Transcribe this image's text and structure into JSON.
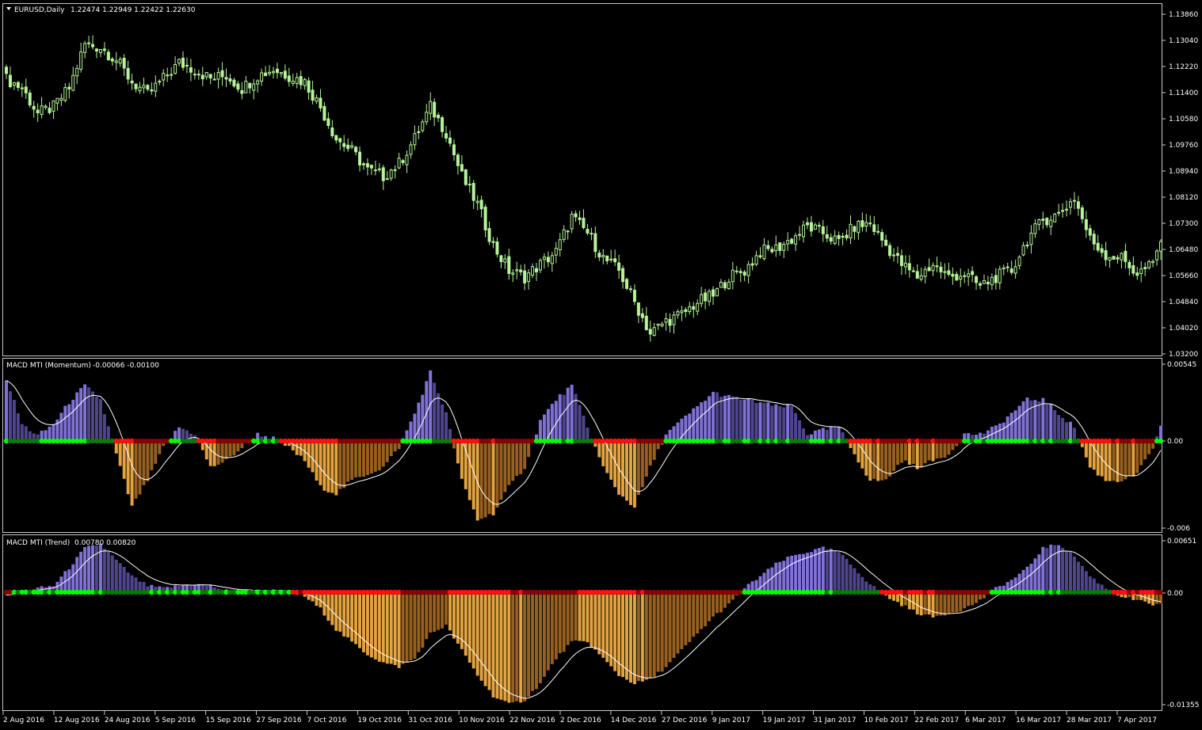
{
  "colors": {
    "background": "#000000",
    "candle": "#b6f39a",
    "hist_pos_strong": "#8071d8",
    "hist_pos_weak": "#4f458d",
    "hist_neg_strong": "#e3a33f",
    "hist_neg_weak": "#98601f",
    "dot_red": "#ff1010",
    "dot_darkred": "#8a0000",
    "dot_green": "#00ff00",
    "dot_darkgreen": "#0a7a0a",
    "signal_line": "#ffffff",
    "border": "#c8c8c8"
  },
  "chart_data": [
    {
      "type": "candlestick",
      "symbol_label": "EURUSD,Daily",
      "ohlc_label": "1.22474 1.22949 1.22422 1.22630",
      "ylim": [
        1.032,
        1.14
      ],
      "y_ticks": [
        "1.13860",
        "1.13040",
        "1.12220",
        "1.11400",
        "1.10580",
        "1.09760",
        "1.08940",
        "1.08120",
        "1.07300",
        "1.06480",
        "1.05660",
        "1.04840",
        "1.04020",
        "1.03200"
      ],
      "closes_anchor": [
        [
          0,
          1.121
        ],
        [
          4,
          1.118
        ],
        [
          8,
          1.11
        ],
        [
          12,
          1.112
        ],
        [
          16,
          1.118
        ],
        [
          20,
          1.132
        ],
        [
          24,
          1.131
        ],
        [
          28,
          1.127
        ],
        [
          32,
          1.12
        ],
        [
          36,
          1.116
        ],
        [
          40,
          1.121
        ],
        [
          44,
          1.126
        ],
        [
          48,
          1.124
        ],
        [
          52,
          1.121
        ],
        [
          56,
          1.122
        ],
        [
          60,
          1.118
        ],
        [
          64,
          1.122
        ],
        [
          68,
          1.124
        ],
        [
          72,
          1.122
        ],
        [
          76,
          1.12
        ],
        [
          80,
          1.112
        ],
        [
          84,
          1.102
        ],
        [
          88,
          1.098
        ],
        [
          92,
          1.092
        ],
        [
          96,
          1.09
        ],
        [
          100,
          1.094
        ],
        [
          104,
          1.102
        ],
        [
          108,
          1.112
        ],
        [
          112,
          1.104
        ],
        [
          116,
          1.09
        ],
        [
          120,
          1.081
        ],
        [
          124,
          1.068
        ],
        [
          128,
          1.06
        ],
        [
          132,
          1.058
        ],
        [
          136,
          1.062
        ],
        [
          140,
          1.066
        ],
        [
          144,
          1.077
        ],
        [
          148,
          1.072
        ],
        [
          152,
          1.064
        ],
        [
          156,
          1.06
        ],
        [
          160,
          1.05
        ],
        [
          164,
          1.04
        ],
        [
          168,
          1.044
        ],
        [
          172,
          1.046
        ],
        [
          176,
          1.05
        ],
        [
          180,
          1.052
        ],
        [
          184,
          1.058
        ],
        [
          188,
          1.06
        ],
        [
          192,
          1.066
        ],
        [
          196,
          1.067
        ],
        [
          200,
          1.07
        ],
        [
          204,
          1.074
        ],
        [
          208,
          1.072
        ],
        [
          212,
          1.069
        ],
        [
          216,
          1.074
        ],
        [
          220,
          1.075
        ],
        [
          224,
          1.068
        ],
        [
          228,
          1.062
        ],
        [
          232,
          1.058
        ],
        [
          236,
          1.062
        ],
        [
          240,
          1.058
        ],
        [
          244,
          1.059
        ],
        [
          248,
          1.055
        ],
        [
          252,
          1.058
        ],
        [
          256,
          1.06
        ],
        [
          260,
          1.07
        ],
        [
          264,
          1.076
        ],
        [
          268,
          1.078
        ],
        [
          272,
          1.083
        ],
        [
          276,
          1.07
        ],
        [
          280,
          1.065
        ],
        [
          284,
          1.064
        ],
        [
          288,
          1.059
        ],
        [
          292,
          1.062
        ],
        [
          294,
          1.07
        ]
      ],
      "x_ticks": [
        "2 Aug 2016",
        "12 Aug 2016",
        "24 Aug 2016",
        "5 Sep 2016",
        "15 Sep 2016",
        "27 Sep 2016",
        "7 Oct 2016",
        "19 Oct 2016",
        "31 Oct 2016",
        "10 Nov 2016",
        "22 Nov 2016",
        "2 Dec 2016",
        "14 Dec 2016",
        "27 Dec 2016",
        "9 Jan 2017",
        "19 Jan 2017",
        "31 Jan 2017",
        "10 Feb 2017",
        "22 Feb 2017",
        "6 Mar 2017",
        "16 Mar 2017",
        "28 Mar 2017",
        "7 Apr 2017"
      ]
    },
    {
      "type": "histogram",
      "name": "MACD MTI (Momentum)",
      "values_label": "-0.00066 -0.00100",
      "ylim": [
        -0.0065,
        0.00545
      ],
      "y_ticks": [
        "0.00545",
        "0.00",
        "-0.006"
      ],
      "hist_anchor": [
        [
          0,
          0.0045
        ],
        [
          4,
          0.0012
        ],
        [
          8,
          0.0004
        ],
        [
          12,
          0.0012
        ],
        [
          16,
          0.0028
        ],
        [
          20,
          0.004
        ],
        [
          24,
          0.003
        ],
        [
          28,
          -0.001
        ],
        [
          32,
          -0.005
        ],
        [
          36,
          -0.003
        ],
        [
          40,
          -0.0005
        ],
        [
          44,
          0.001
        ],
        [
          48,
          0.0005
        ],
        [
          52,
          -0.002
        ],
        [
          56,
          -0.0015
        ],
        [
          60,
          -0.0005
        ],
        [
          64,
          0.0005
        ],
        [
          68,
          0.0002
        ],
        [
          72,
          -0.0005
        ],
        [
          76,
          -0.0015
        ],
        [
          80,
          -0.0035
        ],
        [
          84,
          -0.004
        ],
        [
          88,
          -0.003
        ],
        [
          92,
          -0.0025
        ],
        [
          96,
          -0.002
        ],
        [
          100,
          -0.0005
        ],
        [
          104,
          0.002
        ],
        [
          108,
          0.005
        ],
        [
          112,
          0.002
        ],
        [
          116,
          -0.003
        ],
        [
          120,
          -0.006
        ],
        [
          124,
          -0.0055
        ],
        [
          128,
          -0.0035
        ],
        [
          132,
          -0.002
        ],
        [
          136,
          0.0015
        ],
        [
          140,
          0.003
        ],
        [
          144,
          0.004
        ],
        [
          148,
          0.001
        ],
        [
          152,
          -0.002
        ],
        [
          156,
          -0.004
        ],
        [
          160,
          -0.005
        ],
        [
          164,
          -0.002
        ],
        [
          168,
          0.0005
        ],
        [
          172,
          0.0015
        ],
        [
          176,
          0.0025
        ],
        [
          180,
          0.0035
        ],
        [
          184,
          0.0032
        ],
        [
          188,
          0.003
        ],
        [
          192,
          0.0028
        ],
        [
          196,
          0.0025
        ],
        [
          200,
          0.0025
        ],
        [
          204,
          0.0005
        ],
        [
          208,
          0.0008
        ],
        [
          212,
          0.001
        ],
        [
          216,
          -0.001
        ],
        [
          220,
          -0.003
        ],
        [
          224,
          -0.003
        ],
        [
          228,
          -0.0015
        ],
        [
          232,
          -0.002
        ],
        [
          236,
          -0.0015
        ],
        [
          240,
          -0.001
        ],
        [
          244,
          0.0005
        ],
        [
          248,
          0.0005
        ],
        [
          252,
          0.001
        ],
        [
          256,
          0.002
        ],
        [
          260,
          0.003
        ],
        [
          264,
          0.003
        ],
        [
          268,
          0.002
        ],
        [
          272,
          0.001
        ],
        [
          276,
          -0.002
        ],
        [
          280,
          -0.003
        ],
        [
          284,
          -0.003
        ],
        [
          288,
          -0.0025
        ],
        [
          292,
          -0.0005
        ],
        [
          294,
          0.001
        ]
      ]
    },
    {
      "type": "histogram",
      "name": "MACD MTI (Trend)",
      "values_label": "0.00780 0.00820",
      "ylim": [
        -0.01355,
        0.00651
      ],
      "y_ticks": [
        "0.00651",
        "0.00",
        "-0.01355"
      ],
      "hist_anchor": [
        [
          0,
          -0.0002
        ],
        [
          8,
          0.0005
        ],
        [
          12,
          0.0008
        ],
        [
          16,
          0.003
        ],
        [
          20,
          0.0055
        ],
        [
          24,
          0.006
        ],
        [
          28,
          0.004
        ],
        [
          32,
          0.002
        ],
        [
          36,
          0.0008
        ],
        [
          40,
          0.0005
        ],
        [
          44,
          0.0008
        ],
        [
          48,
          0.001
        ],
        [
          52,
          0.0008
        ],
        [
          56,
          0.0002
        ],
        [
          60,
          0.0002
        ],
        [
          64,
          0.0002
        ],
        [
          68,
          0.0002
        ],
        [
          72,
          0.0
        ],
        [
          76,
          -0.0005
        ],
        [
          80,
          -0.002
        ],
        [
          84,
          -0.0045
        ],
        [
          88,
          -0.006
        ],
        [
          92,
          -0.0075
        ],
        [
          96,
          -0.0085
        ],
        [
          100,
          -0.009
        ],
        [
          104,
          -0.008
        ],
        [
          108,
          -0.005
        ],
        [
          112,
          -0.004
        ],
        [
          116,
          -0.007
        ],
        [
          120,
          -0.01
        ],
        [
          124,
          -0.0125
        ],
        [
          128,
          -0.0135
        ],
        [
          132,
          -0.013
        ],
        [
          136,
          -0.011
        ],
        [
          140,
          -0.008
        ],
        [
          144,
          -0.006
        ],
        [
          148,
          -0.006
        ],
        [
          152,
          -0.008
        ],
        [
          156,
          -0.01
        ],
        [
          160,
          -0.011
        ],
        [
          164,
          -0.0105
        ],
        [
          168,
          -0.009
        ],
        [
          172,
          -0.007
        ],
        [
          176,
          -0.005
        ],
        [
          180,
          -0.003
        ],
        [
          184,
          -0.0015
        ],
        [
          188,
          0.0005
        ],
        [
          192,
          0.002
        ],
        [
          196,
          0.0035
        ],
        [
          200,
          0.0045
        ],
        [
          204,
          0.005
        ],
        [
          208,
          0.0055
        ],
        [
          212,
          0.005
        ],
        [
          216,
          0.003
        ],
        [
          220,
          0.001
        ],
        [
          224,
          -0.0005
        ],
        [
          228,
          -0.0015
        ],
        [
          232,
          -0.0025
        ],
        [
          236,
          -0.003
        ],
        [
          240,
          -0.0025
        ],
        [
          244,
          -0.002
        ],
        [
          248,
          -0.001
        ],
        [
          252,
          0.0005
        ],
        [
          256,
          0.0015
        ],
        [
          260,
          0.003
        ],
        [
          264,
          0.0055
        ],
        [
          268,
          0.006
        ],
        [
          272,
          0.0045
        ],
        [
          276,
          0.002
        ],
        [
          280,
          0.0005
        ],
        [
          284,
          -0.0005
        ],
        [
          288,
          -0.001
        ],
        [
          292,
          -0.0015
        ],
        [
          294,
          -0.0015
        ]
      ]
    }
  ]
}
